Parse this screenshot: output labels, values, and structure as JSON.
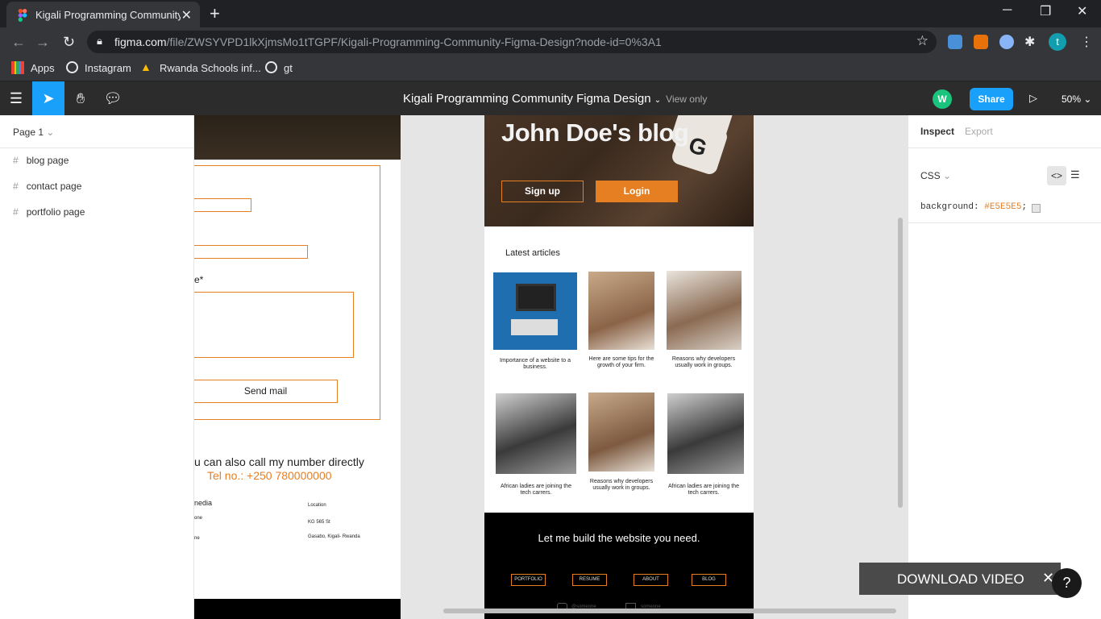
{
  "browser": {
    "tab_title": "Kigali Programming Community",
    "new_tab": "+",
    "tab_close": "✕",
    "url_domain": "figma.com",
    "url_path": "/file/ZWSYVPD1lkXjmsMo1tTGPF/Kigali-Programming-Community-Figma-Design?node-id=0%3A1",
    "profile_initial": "t",
    "bookmarks": [
      "Apps",
      "Instagram",
      "Rwanda Schools inf...",
      "gt"
    ]
  },
  "figma": {
    "doc_title": "Kigali Programming Community Figma Design",
    "view_mode": "View only",
    "avatar_initial": "W",
    "share_label": "Share",
    "zoom": "50%",
    "page_selector": "Page 1",
    "pages": [
      "blog page",
      "contact page",
      "portfolio page"
    ],
    "inspect_tab": "Inspect",
    "export_tab": "Export",
    "code_lang": "CSS",
    "css_prop": "background:",
    "css_value": "#E5E5E5",
    "css_semicolon": ";"
  },
  "contact_page": {
    "message_label": "e*",
    "send_label": "Send mail",
    "call_text": "u can also call my number  directly",
    "tel": "Tel no.: +250 780000000",
    "media_label": "nedia",
    "phone1": "one",
    "phone2": "ne",
    "location_label": "Location",
    "street": "KG 565 St",
    "area": "Gasabo, Kigali- Rwanda"
  },
  "blog_page": {
    "title": "John Doe's blog",
    "signup": "Sign up",
    "login": "Login",
    "latest": "Latest articles",
    "articles": [
      "Importance of a website to a business.",
      "Here are some tips for the growth of your firm.",
      "Reasons why developers usually work in groups.",
      "African ladies are joining the tech carrers.",
      "Reasons why developers usually work in groups.",
      "African ladies are joining the tech carrers."
    ],
    "cta": "Let me build the website you need.",
    "footer_links": [
      "PORTFOLIO",
      "RESUME",
      "ABOUT",
      "BLOG"
    ],
    "social1": "@someone",
    "social2": "someone"
  },
  "overlay": {
    "download_label": "DOWNLOAD VIDEO",
    "close": "✕",
    "help": "?"
  },
  "colors": {
    "accent": "#e67e22",
    "figma_blue": "#18a0fb",
    "avatar_green": "#1bc47d"
  }
}
